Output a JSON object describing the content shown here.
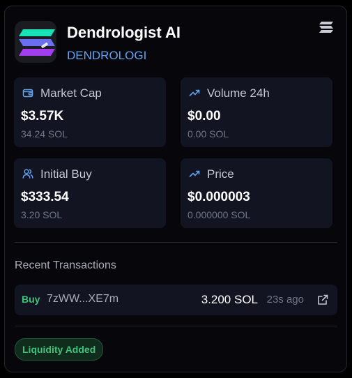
{
  "token": {
    "name": "Dendrologist AI",
    "ticker": "DENDROLOGI",
    "logo_icon": "solana-logo-icon"
  },
  "header": {
    "menu_icon": "solana-menu-icon"
  },
  "stats": [
    {
      "icon": "wallet-icon",
      "label": "Market Cap",
      "value": "$3.57K",
      "sub": "34.24 SOL"
    },
    {
      "icon": "trending-up-icon",
      "label": "Volume 24h",
      "value": "$0.00",
      "sub": "0.00 SOL"
    },
    {
      "icon": "users-icon",
      "label": "Initial Buy",
      "value": "$333.54",
      "sub": "3.20 SOL"
    },
    {
      "icon": "trending-up-icon",
      "label": "Price",
      "value": "$0.000003",
      "sub": "0.000000 SOL"
    }
  ],
  "transactions": {
    "title": "Recent Transactions",
    "items": [
      {
        "type": "Buy",
        "address": "7zWW...XE7m",
        "amount": "3.200 SOL",
        "time": "23s ago",
        "link_icon": "external-link-icon"
      }
    ]
  },
  "status_badge": "Liquidity Added",
  "colors": {
    "accent_blue": "#5fa4f0",
    "buy_green": "#3ec47a",
    "card_bg": "#121521",
    "panel_bg": "#07070b"
  }
}
